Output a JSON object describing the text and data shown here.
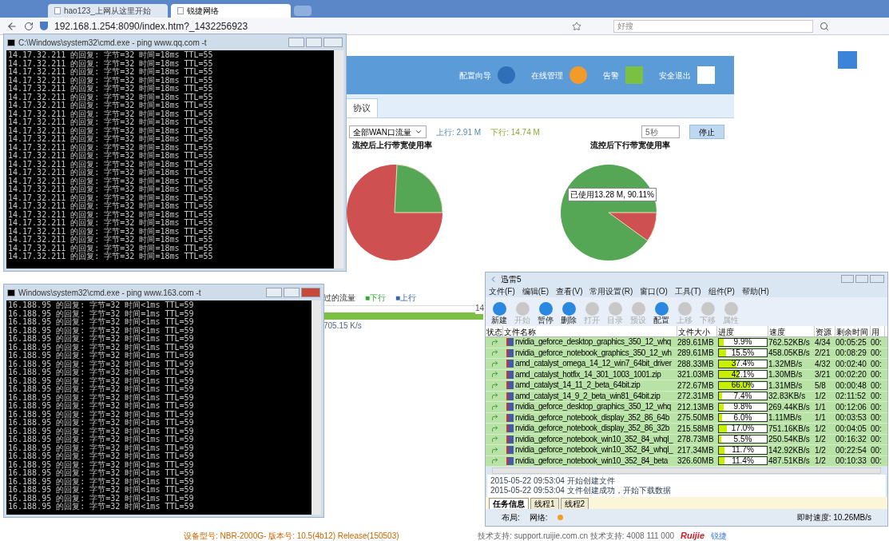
{
  "browser": {
    "tabs": [
      {
        "label": "hao123_上网从这里开始",
        "selected": false
      },
      {
        "label": "锐捷网络",
        "selected": true
      }
    ],
    "address": "192.168.1.254:8090/index.htm?_1432256923",
    "search": {
      "placeholder": "好搜"
    }
  },
  "web": {
    "nav": [
      "配置向导",
      "在线管理",
      "告警",
      "安全退出"
    ],
    "tab": "协议",
    "wan_select": "全部WAN口流量",
    "up": "上行: 2.91 M",
    "down": "下行: 14.74 M",
    "interval": "5秒",
    "stop_button": "停止",
    "up_title": "流控后上行带宽使用率",
    "down_title": "流控后下行带宽使用率",
    "pie_label": "已使用13.28 M, 90.11%",
    "flow_title": "过的流量",
    "legend": [
      "■下行",
      "■上行"
    ],
    "bar_value": "14",
    "rate": "705.15 K/s",
    "footer": {
      "device": "设备型号: NBR-2000G-  版本号: 10.5(4b12) Release(150503)",
      "support": "技术支持: support.ruijie.com.cn  技术支持: 4008 111 000",
      "logo": "Ruijie",
      "brand": "锐捷"
    }
  },
  "cmd_windows": [
    {
      "title": "C:\\Windows\\system32\\cmd.exe - ping  www.qq.com -t",
      "lines": [
        "14.17.32.211 的回复: 字节=32 时间=18ms TTL=55",
        "14.17.32.211 的回复: 字节=32 时间=18ms TTL=55",
        "14.17.32.211 的回复: 字节=32 时间=18ms TTL=55",
        "14.17.32.211 的回复: 字节=32 时间=18ms TTL=55",
        "14.17.32.211 的回复: 字节=32 时间=18ms TTL=55",
        "14.17.32.211 的回复: 字节=32 时间=18ms TTL=55",
        "14.17.32.211 的回复: 字节=32 时间=18ms TTL=55",
        "14.17.32.211 的回复: 字节=32 时间=18ms TTL=55",
        "14.17.32.211 的回复: 字节=32 时间=18ms TTL=55",
        "14.17.32.211 的回复: 字节=32 时间=18ms TTL=55",
        "14.17.32.211 的回复: 字节=32 时间=18ms TTL=55",
        "14.17.32.211 的回复: 字节=32 时间=18ms TTL=55",
        "14.17.32.211 的回复: 字节=32 时间=18ms TTL=55",
        "14.17.32.211 的回复: 字节=32 时间=18ms TTL=55",
        "14.17.32.211 的回复: 字节=32 时间=18ms TTL=55",
        "14.17.32.211 的回复: 字节=32 时间=18ms TTL=55",
        "14.17.32.211 的回复: 字节=32 时间=18ms TTL=55",
        "14.17.32.211 的回复: 字节=32 时间=18ms TTL=55",
        "14.17.32.211 的回复: 字节=32 时间=18ms TTL=55",
        "14.17.32.211 的回复: 字节=32 时间=18ms TTL=55",
        "14.17.32.211 的回复: 字节=32 时间=18ms TTL=55",
        "14.17.32.211 的回复: 字节=32 时间=18ms TTL=55",
        "14.17.32.211 的回复: 字节=32 时间=18ms TTL=55",
        "14.17.32.211 的回复: 字节=32 时间=18ms TTL=55",
        "14.17.32.211 的回复: 字节=32 时间=18ms TTL=55"
      ]
    },
    {
      "title": "Windows\\system32\\cmd.exe - ping  www.163.com -t",
      "lines": [
        "16.188.95 的回复: 字节=32 时间<1ms TTL=59",
        "16.188.95 的回复: 字节=32 时间=1ms TTL=59",
        "16.188.95 的回复: 字节=32 时间<1ms TTL=59",
        "16.188.95 的回复: 字节=32 时间<1ms TTL=59",
        "16.188.95 的回复: 字节=32 时间<1ms TTL=59",
        "16.188.95 的回复: 字节=32 时间<1ms TTL=59",
        "16.188.95 的回复: 字节=32 时间<1ms TTL=59",
        "16.188.95 的回复: 字节=32 时间<1ms TTL=59",
        "16.188.95 的回复: 字节=32 时间<1ms TTL=59",
        "16.188.95 的回复: 字节=32 时间<1ms TTL=59",
        "16.188.95 的回复: 字节=32 时间<1ms TTL=59",
        "16.188.95 的回复: 字节=32 时间<1ms TTL=59",
        "16.188.95 的回复: 字节=32 时间<1ms TTL=59",
        "16.188.95 的回复: 字节=32 时间<1ms TTL=59",
        "16.188.95 的回复: 字节=32 时间<1ms TTL=59",
        "16.188.95 的回复: 字节=32 时间<1ms TTL=59",
        "16.188.95 的回复: 字节=32 时间<1ms TTL=59",
        "16.188.95 的回复: 字节=32 时间<1ms TTL=59",
        "16.188.95 的回复: 字节=32 时间<1ms TTL=59",
        "16.188.95 的回复: 字节=32 时间<1ms TTL=59",
        "16.188.95 的回复: 字节=32 时间<1ms TTL=59",
        "16.188.95 的回复: 字节=32 时间<1ms TTL=59",
        "16.188.95 的回复: 字节=32 时间<1ms TTL=59",
        "16.188.95 的回复: 字节=32 时间<1ms TTL=59",
        "16.188.95 的回复: 字节=32 时间<1ms TTL=59"
      ]
    }
  ],
  "downloader": {
    "title": "迅雷5",
    "menu": [
      "文件(F)",
      "编辑(E)",
      "查看(V)",
      "常用设置(R)",
      "窗口(O)",
      "工具(T)",
      "组件(P)",
      "帮助(H)"
    ],
    "toolbar": [
      {
        "label": "新建",
        "disabled": false
      },
      {
        "label": "开始",
        "disabled": true
      },
      {
        "label": "暂停",
        "disabled": false
      },
      {
        "label": "删除",
        "disabled": false
      },
      {
        "label": "打开",
        "disabled": true
      },
      {
        "label": "目录",
        "disabled": true
      },
      {
        "label": "预设",
        "disabled": true
      },
      {
        "label": "配置",
        "disabled": false
      },
      {
        "label": "上移",
        "disabled": true
      },
      {
        "label": "下移",
        "disabled": true
      },
      {
        "label": "属性",
        "disabled": true
      }
    ],
    "columns": [
      "状态",
      "文件名称",
      "文件大小",
      "进度",
      "速度",
      "资源",
      "剩余时间",
      "用"
    ],
    "rows": [
      {
        "name": "nvidia_geforce_desktop_graphics_350_12_whq",
        "size": "289.61MB",
        "level": 0.099,
        "progress": "9.9%",
        "speed": "762.52KB/s",
        "sources": "4/34",
        "remaining": "00:05:25",
        "used": "00:"
      },
      {
        "name": "nvidia_geforce_notebook_graphics_350_12_wh",
        "size": "289.61MB",
        "level": 0.155,
        "progress": "15.5%",
        "speed": "458.05KB/s",
        "sources": "2/21",
        "remaining": "00:08:29",
        "used": "00:"
      },
      {
        "name": "amd_catalyst_omega_14_12_win7_64bit_driver",
        "size": "288.33MB",
        "level": 0.374,
        "progress": "37.4%",
        "speed": "1.32MB/s",
        "sources": "4/32",
        "remaining": "00:02:40",
        "used": "00:"
      },
      {
        "name": "amd_catalyst_hotfix_14_301_1003_1001.zip",
        "size": "321.03MB",
        "level": 0.421,
        "progress": "42.1%",
        "speed": "1.30MB/s",
        "sources": "3/21",
        "remaining": "00:02:20",
        "used": "00:"
      },
      {
        "name": "amd_catalyst_14_11_2_beta_64bit.zip",
        "size": "272.67MB",
        "level": 0.66,
        "progress": "66.0%",
        "speed": "1.31MB/s",
        "sources": "5/8",
        "remaining": "00:00:48",
        "used": "00:"
      },
      {
        "name": "amd_catalyst_14_9_2_beta_win81_64bit.zip",
        "size": "272.31MB",
        "level": 0.074,
        "progress": "7.4%",
        "speed": "32.83KB/s",
        "sources": "1/2",
        "remaining": "02:11:52",
        "used": "00:"
      },
      {
        "name": "nvidia_geforce_desktop_graphics_350_12_whq",
        "size": "212.13MB",
        "level": 0.098,
        "progress": "9.8%",
        "speed": "269.44KB/s",
        "sources": "1/1",
        "remaining": "00:12:06",
        "used": "00:"
      },
      {
        "name": "nvidia_geforce_notebook_display_352_86_64b",
        "size": "275.50MB",
        "level": 0.06,
        "progress": "6.0%",
        "speed": "1.11MB/s",
        "sources": "1/1",
        "remaining": "00:03:53",
        "used": "00:"
      },
      {
        "name": "nvidia_geforce_notebook_display_352_86_32b",
        "size": "215.58MB",
        "level": 0.17,
        "progress": "17.0%",
        "speed": "751.16KB/s",
        "sources": "1/2",
        "remaining": "00:04:05",
        "used": "00:"
      },
      {
        "name": "nvidia_geforce_notebook_win10_352_84_whql_",
        "size": "278.73MB",
        "level": 0.055,
        "progress": "5.5%",
        "speed": "250.54KB/s",
        "sources": "1/2",
        "remaining": "00:16:32",
        "used": "00:"
      },
      {
        "name": "nvidia_geforce_notebook_win10_352_84_whql_",
        "size": "217.34MB",
        "level": 0.117,
        "progress": "11.7%",
        "speed": "142.92KB/s",
        "sources": "1/2",
        "remaining": "00:22:54",
        "used": "00:"
      },
      {
        "name": "nvidia_geforce_notebook_win10_352_84_beta",
        "size": "326.60MB",
        "level": 0.114,
        "progress": "11.4%",
        "speed": "487.51KB/s",
        "sources": "1/2",
        "remaining": "00:10:33",
        "used": "00:"
      }
    ],
    "log": [
      "2015-05-22 09:53:04 开始创建文件",
      "2015-05-22 09:53:04 文件创建成功，开始下载数据"
    ],
    "tabs": [
      {
        "label": "任务信息",
        "selected": true
      },
      {
        "label": "线程1",
        "selected": false
      },
      {
        "label": "线程2",
        "selected": false
      }
    ],
    "status": {
      "layout": "布局:",
      "network": "网络:",
      "speed": "即时速度: 10.26MB/s"
    }
  }
}
